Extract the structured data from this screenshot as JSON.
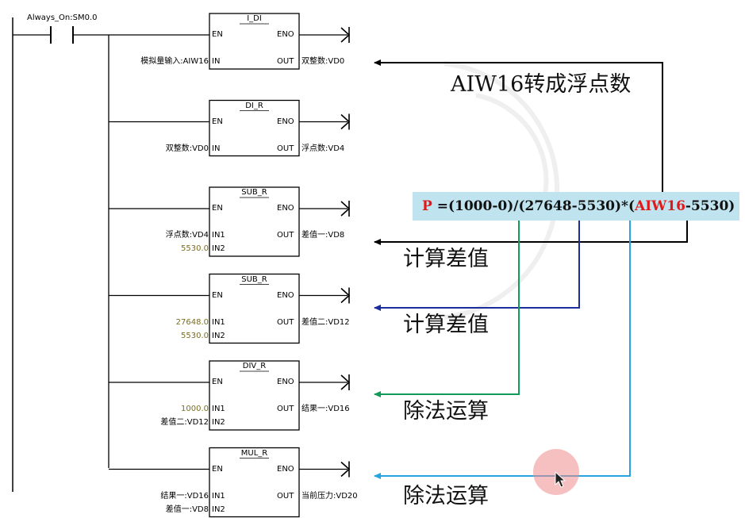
{
  "contact": {
    "label": "Always_On:SM0.0"
  },
  "blocks": [
    {
      "name": "I_DI",
      "en": "EN",
      "eno": "ENO",
      "in1_pin": "IN",
      "out_pin": "OUT",
      "in1": "模拟量输入:AIW16",
      "in1_const": false,
      "out": "双整数:VD0"
    },
    {
      "name": "DI_R",
      "en": "EN",
      "eno": "ENO",
      "in1_pin": "IN",
      "out_pin": "OUT",
      "in1": "双整数:VD0",
      "in1_const": false,
      "out": "浮点数:VD4"
    },
    {
      "name": "SUB_R",
      "en": "EN",
      "eno": "ENO",
      "in1_pin": "IN1",
      "in2_pin": "IN2",
      "out_pin": "OUT",
      "in1": "浮点数:VD4",
      "in1_const": false,
      "in2": "5530.0",
      "in2_const": true,
      "out": "差值一:VD8"
    },
    {
      "name": "SUB_R",
      "en": "EN",
      "eno": "ENO",
      "in1_pin": "IN1",
      "in2_pin": "IN2",
      "out_pin": "OUT",
      "in1": "27648.0",
      "in1_const": true,
      "in2": "5530.0",
      "in2_const": true,
      "out": "差值二:VD12"
    },
    {
      "name": "DIV_R",
      "en": "EN",
      "eno": "ENO",
      "in1_pin": "IN1",
      "in2_pin": "IN2",
      "out_pin": "OUT",
      "in1": "1000.0",
      "in1_const": true,
      "in2": "差值二:VD12",
      "in2_const": false,
      "out": "结果一:VD16"
    },
    {
      "name": "MUL_R",
      "en": "EN",
      "eno": "ENO",
      "in1_pin": "IN1",
      "in2_pin": "IN2",
      "out_pin": "OUT",
      "in1": "结果一:VD16",
      "in1_const": false,
      "in2": "差值一:VD8",
      "in2_const": false,
      "out": "当前压力:VD20"
    }
  ],
  "annotations": [
    "AIW16转成浮点数",
    "计算差值",
    "计算差值",
    "除法运算",
    "除法运算"
  ],
  "formula": {
    "p": "P",
    "part1": " =(1000-0)/(27648-5530)*(",
    "aiw": "AIW16",
    "part2": "-5530)"
  },
  "colors": {
    "formula_bg": "#bfe3ef",
    "formula_red": "#e0191a",
    "arrow_black": "#000000",
    "arrow_navy": "#1a2d9a",
    "arrow_green": "#129a5a",
    "arrow_sky": "#29a3e0",
    "constant_olive": "#7a6d1e"
  }
}
